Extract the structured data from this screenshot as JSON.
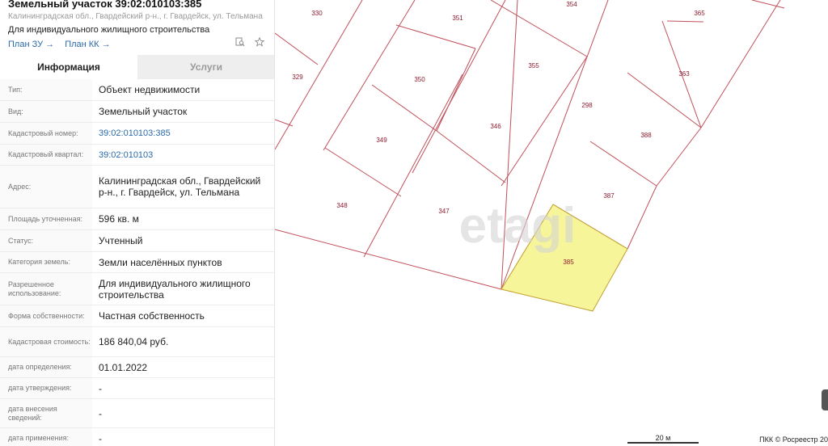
{
  "header": {
    "title": "Земельный участок 39:02:010103:385",
    "address": "Калининградская обл., Гвардейский р-н., г. Гвардейск, ул. Тельмана",
    "purpose": "Для индивидуального жилищного строительства",
    "link_zu": "План ЗУ →",
    "link_kk": "План КК →"
  },
  "tabs": {
    "info": "Информация",
    "services": "Услуги"
  },
  "rows": [
    {
      "label": "Тип:",
      "value": "Объект недвижимости"
    },
    {
      "label": "Вид:",
      "value": "Земельный участок"
    },
    {
      "label": "Кадастровый номер:",
      "value": "39:02:010103:385"
    },
    {
      "label": "Кадастровый квартал:",
      "value": "39:02:010103"
    },
    {
      "label": "Адрес:",
      "value": "Калининградская обл., Гвардейский р-н., г. Гвардейск, ул. Тельмана"
    },
    {
      "label": "Площадь уточненная:",
      "value": "596 кв. м"
    },
    {
      "label": "Статус:",
      "value": "Учтенный"
    },
    {
      "label": "Категория земель:",
      "value": "Земли населённых пунктов"
    },
    {
      "label": "Разрешенное использование:",
      "value": "Для индивидуального жилищного строительства"
    },
    {
      "label": "Форма собственности:",
      "value": "Частная собственность"
    },
    {
      "label": "Кадастровая стоимость:",
      "value": "186 840,04 руб."
    },
    {
      "label": "дата определения:",
      "value": "01.01.2022"
    },
    {
      "label": "дата утверждения:",
      "value": "-"
    },
    {
      "label": "дата внесения сведений:",
      "value": "-"
    },
    {
      "label": "дата применения:",
      "value": "-"
    }
  ],
  "map": {
    "parcels": [
      "330",
      "351",
      "354",
      "365",
      "329",
      "350",
      "355",
      "363",
      "298",
      "346",
      "349",
      "388",
      "387",
      "348",
      "347",
      "385"
    ],
    "highlighted_parcel": "385",
    "highlight_color": "#f7f59a",
    "line_color": "#c0505a",
    "watermark": "etagi",
    "scale_label": "20 м",
    "copyright": "ПКК © Росреестр 20"
  },
  "icons": {
    "search": "search-doc-icon",
    "star": "star-icon"
  }
}
